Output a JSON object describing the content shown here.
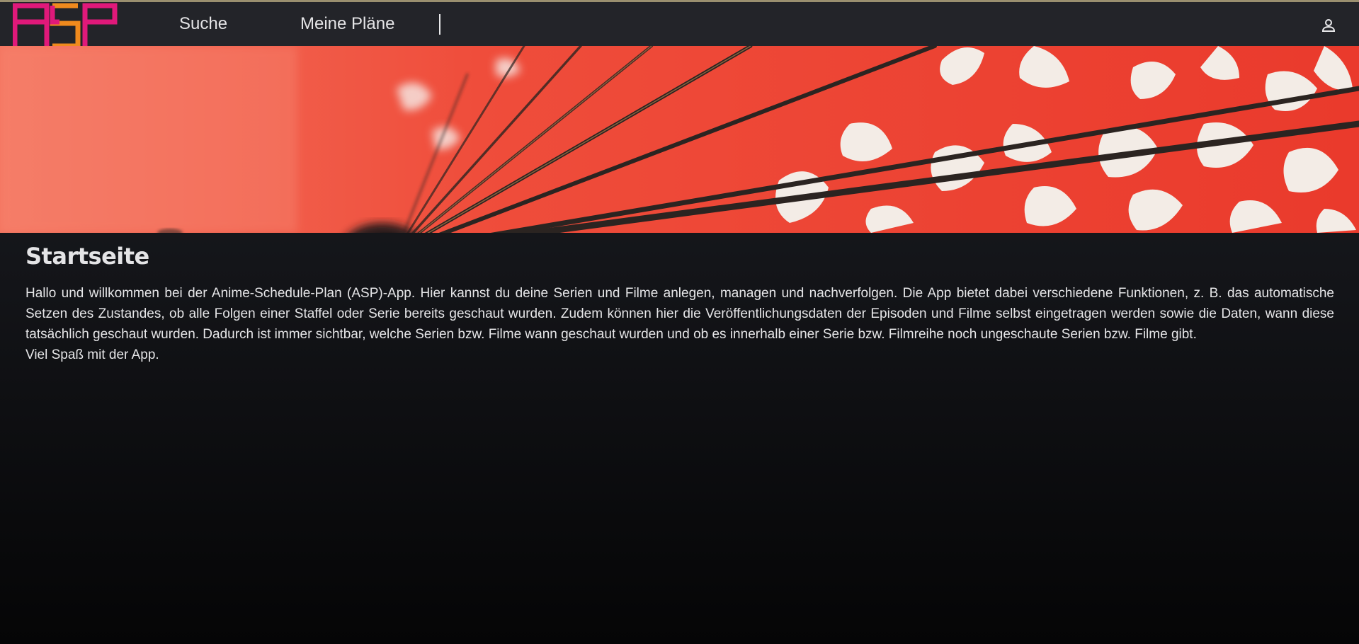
{
  "nav": {
    "logo_text": "ASP",
    "links": [
      {
        "label": "Suche"
      },
      {
        "label": "Meine Pläne"
      }
    ],
    "user_icon": "user-icon"
  },
  "hero": {
    "image": "red-paper-umbrella-banner",
    "colors": {
      "red": "#f0503e",
      "white": "#f3ece6",
      "rib": "#2a2320"
    }
  },
  "main": {
    "title": "Startseite",
    "intro": "Hallo und willkommen bei der Anime-Schedule-Plan (ASP)-App. Hier kannst du deine Serien und Filme anlegen, managen und nachverfolgen. Die App bietet dabei verschiedene Funktionen, z. B. das automatische Setzen des Zustandes, ob alle Folgen einer Staffel oder Serie bereits geschaut wurden. Zudem können hier die Veröffentlichungsdaten der Episoden und Filme selbst eingetragen werden sowie die Daten, wann diese tatsächlich geschaut wurden. Dadurch ist immer sichtbar, welche Serien bzw. Filme wann geschaut wurden und ob es innerhalb einer Serie bzw. Filmreihe noch ungeschaute Serien bzw. Filme gibt.",
    "closing": "Viel Spaß mit der App."
  },
  "colors": {
    "navbar_bg": "#232429",
    "logo_pink": "#e0197a",
    "logo_orange": "#f08a1d",
    "text": "#e6e6e8"
  }
}
